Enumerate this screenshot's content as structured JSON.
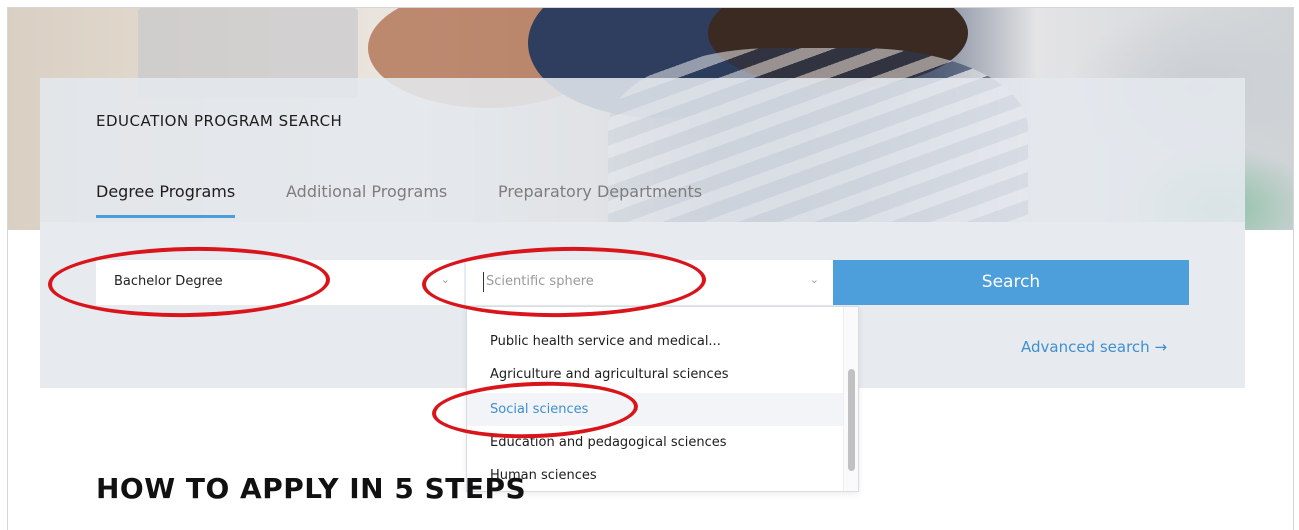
{
  "panel": {
    "title": "EDUCATION PROGRAM SEARCH",
    "tabs": [
      {
        "label": "Degree Programs",
        "active": true
      },
      {
        "label": "Additional Programs",
        "active": false
      },
      {
        "label": "Preparatory Departments",
        "active": false
      }
    ]
  },
  "filters": {
    "degree_value": "Bachelor Degree",
    "sphere_placeholder": "Scientific sphere",
    "search_label": "Search",
    "advanced_label": "Advanced search →"
  },
  "dropdown": {
    "options": [
      {
        "label": "Public health service and medical...",
        "highlighted": false
      },
      {
        "label": "Agriculture and agricultural sciences",
        "highlighted": false
      },
      {
        "label": "Social sciences",
        "highlighted": true
      },
      {
        "label": "Education and pedagogical sciences",
        "highlighted": false
      },
      {
        "label": "Human sciences",
        "highlighted": false
      }
    ]
  },
  "section": {
    "heading": "HOW TO APPLY IN 5 STEPS"
  },
  "colors": {
    "accent": "#4d9fdc",
    "annotation": "#d9141b"
  },
  "icons": {
    "select_chevron": "chevron-down-icon"
  }
}
